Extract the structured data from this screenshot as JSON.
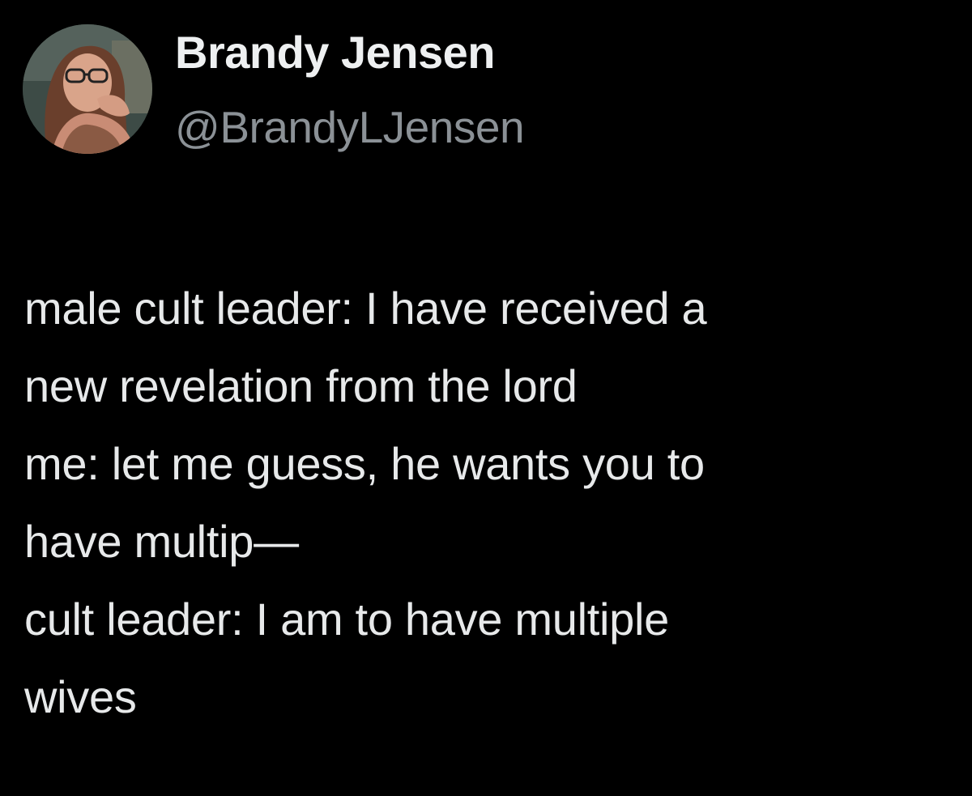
{
  "author": {
    "display_name": "Brandy Jensen",
    "handle": "@BrandyLJensen"
  },
  "tweet": {
    "lines": [
      "male cult leader: I have received a",
      "new revelation from the lord",
      "me: let me guess, he wants you to",
      "have multip—",
      "cult leader: I am to have multiple",
      "wives"
    ]
  },
  "colors": {
    "background": "#000000",
    "name_text": "#eef0f1",
    "handle_text": "#8b9196",
    "body_text": "#e7e9ea"
  }
}
